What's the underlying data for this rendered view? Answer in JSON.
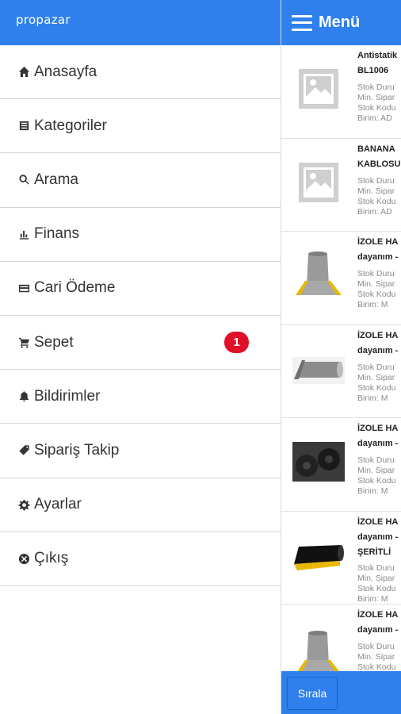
{
  "drawer": {
    "brand": "propazar",
    "items": [
      {
        "label": "Anasayfa",
        "icon": "home-icon"
      },
      {
        "label": "Kategoriler",
        "icon": "list-icon"
      },
      {
        "label": "Arama",
        "icon": "search-icon"
      },
      {
        "label": "Finans",
        "icon": "bar-chart-icon"
      },
      {
        "label": "Cari Ödeme",
        "icon": "credit-card-icon"
      },
      {
        "label": "Sepet",
        "icon": "cart-icon",
        "badge": "1"
      },
      {
        "label": "Bildirimler",
        "icon": "bell-icon"
      },
      {
        "label": "Sipariş Takip",
        "icon": "tag-icon"
      },
      {
        "label": "Ayarlar",
        "icon": "gear-icon"
      },
      {
        "label": "Çıkış",
        "icon": "close-circle-icon"
      }
    ]
  },
  "header": {
    "menu_title": "Menü"
  },
  "products": [
    {
      "title_1": "Antistatik",
      "title_2": "BL1006",
      "meta": [
        "Stok Duru",
        "Min. Sipar",
        "Stok Kodu",
        "Birim: AD"
      ],
      "thumb": "placeholder-image-icon"
    },
    {
      "title_1": "BANANA",
      "title_2": "KABLOSU",
      "meta": [
        "Stok Duru",
        "Min. Sipar",
        "Stok Kodu",
        "Birim: AD"
      ],
      "thumb": "placeholder-image-icon"
    },
    {
      "title_1": "İZOLE HA",
      "title_2": "dayanım -",
      "meta": [
        "Stok Duru",
        "Min. Sipar",
        "Stok Kodu",
        "Birim: M"
      ],
      "thumb": "mat-roll-yellow-edge"
    },
    {
      "title_1": "İZOLE HA",
      "title_2": "dayanım -",
      "meta": [
        "Stok Duru",
        "Min. Sipar",
        "Stok Kodu",
        "Birim: M"
      ],
      "thumb": "mat-roll-grey"
    },
    {
      "title_1": "İZOLE HA",
      "title_2": "dayanım -",
      "meta": [
        "Stok Duru",
        "Min. Sipar",
        "Stok Kodu",
        "Birim: M"
      ],
      "thumb": "mat-roll-black"
    },
    {
      "title_1": "İZOLE HA",
      "title_2": "dayanım -",
      "title_3": "ŞERİTLİ",
      "meta": [
        "Stok Duru",
        "Min. Sipar",
        "Stok Kodu",
        "Birim: M"
      ],
      "thumb": "mat-roll-black-yellow"
    },
    {
      "title_1": "İZOLE HA",
      "title_2": "dayanım -",
      "meta": [
        "Stok Duru",
        "Min. Sipar",
        "Stok Kodu"
      ],
      "thumb": "mat-roll-yellow-edge"
    }
  ],
  "bottom": {
    "sort_label": "Sırala"
  },
  "colors": {
    "primary": "#2f80ed",
    "badge": "#e0102a"
  }
}
